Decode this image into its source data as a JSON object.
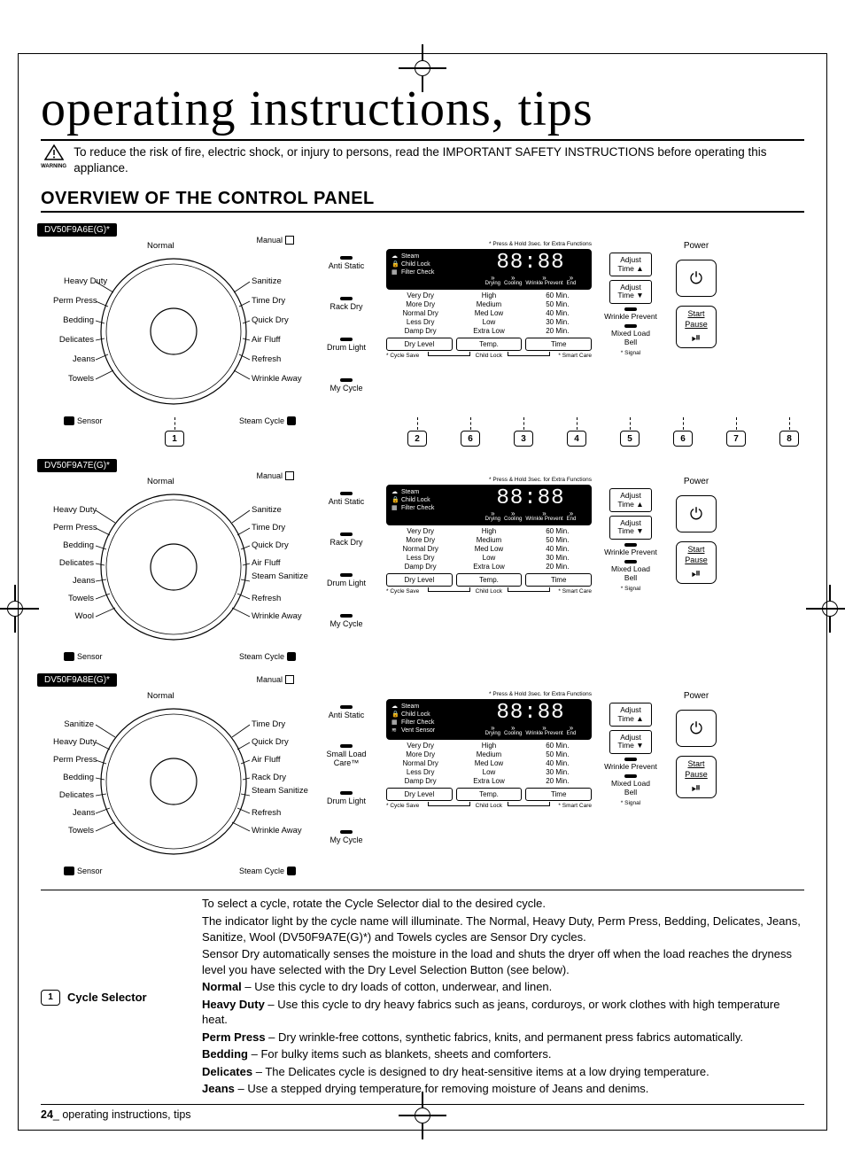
{
  "title": "operating instructions, tips",
  "warning_label": "WARNING",
  "warning_text": "To reduce the risk of fire, electric shock, or injury to persons, read the IMPORTANT SAFETY INSTRUCTIONS before operating this appliance.",
  "section_header": "OVERVIEW OF THE CONTROL PANEL",
  "press_hold_note": "* Press & Hold 3sec. for Extra Functions",
  "models": [
    {
      "id": "DV50F9A6E(G)*",
      "left_labels": [
        "Heavy Duty",
        "Perm Press",
        "Bedding",
        "Delicates",
        "Jeans",
        "Towels"
      ],
      "right_labels": [
        "Sanitize",
        "Time Dry",
        "Quick Dry",
        "Air Fluff",
        "Refresh",
        "Wrinkle Away"
      ],
      "top_label": "Normal",
      "sensor": "Sensor",
      "manual": "Manual",
      "steam": "Steam Cycle"
    },
    {
      "id": "DV50F9A7E(G)*",
      "left_labels": [
        "Heavy Duty",
        "Perm Press",
        "Bedding",
        "Delicates",
        "Jeans",
        "Towels",
        "Wool"
      ],
      "right_labels": [
        "Sanitize",
        "Time Dry",
        "Quick Dry",
        "Air Fluff",
        "Steam Sanitize",
        "Refresh",
        "Wrinkle Away"
      ],
      "top_label": "Normal",
      "sensor": "Sensor",
      "manual": "Manual",
      "steam": "Steam Cycle"
    },
    {
      "id": "DV50F9A8E(G)*",
      "left_labels": [
        "Sanitize",
        "Heavy Duty",
        "Perm Press",
        "Bedding",
        "Delicates",
        "Jeans",
        "Towels"
      ],
      "right_labels": [
        "Time Dry",
        "Quick Dry",
        "Air Fluff",
        "Rack Dry",
        "Steam Sanitize",
        "Refresh",
        "Wrinkle Away"
      ],
      "top_label": "Normal",
      "sensor": "Sensor",
      "manual": "Manual",
      "steam": "Steam Cycle"
    }
  ],
  "option_col": [
    "Anti Static",
    "Rack Dry",
    "Drum Light",
    "My Cycle"
  ],
  "option_col_8e": [
    "Anti Static",
    "Small Load Care™",
    "Drum Light",
    "My Cycle"
  ],
  "lcd": {
    "steam": "Steam",
    "child_lock": "Child Lock",
    "filter_check": "Filter Check",
    "vent_sensor": "Vent Sensor",
    "digits": "88:88",
    "progress": [
      "Drying",
      "Cooling",
      "Wrinkle Prevent",
      "End"
    ]
  },
  "grid": {
    "rows": [
      [
        "Very Dry",
        "High",
        "60 Min."
      ],
      [
        "More Dry",
        "Medium",
        "50 Min."
      ],
      [
        "Normal Dry",
        "Med Low",
        "40 Min."
      ],
      [
        "Less Dry",
        "Low",
        "30 Min."
      ],
      [
        "Damp Dry",
        "Extra Low",
        "20 Min."
      ]
    ]
  },
  "buttons": [
    "Dry Level",
    "Temp.",
    "Time"
  ],
  "foot": {
    "cycle_save": "* Cycle Save",
    "child_lock": "Child Lock",
    "smart_care": "* Smart Care",
    "signal": "* Signal"
  },
  "adjust": {
    "up": "Adjust Time ▲",
    "down": "Adjust Time ▼",
    "wrinkle": "Wrinkle Prevent",
    "mixed": "Mixed Load Bell"
  },
  "power": {
    "power": "Power",
    "start": "Start",
    "pause": "Pause"
  },
  "callouts": [
    "1",
    "2",
    "6",
    "3",
    "4",
    "5",
    "6",
    "7",
    "8"
  ],
  "table": {
    "num": "1",
    "label": "Cycle Selector",
    "paras": [
      "To select a cycle, rotate the Cycle Selector dial to the desired cycle.",
      "The indicator light by the cycle name will illuminate. The Normal, Heavy Duty, Perm Press, Bedding, Delicates, Jeans, Sanitize, Wool (DV50F9A7E(G)*) and Towels cycles are Sensor Dry cycles.",
      "Sensor Dry automatically senses the moisture in the load and shuts the dryer off when the load reaches the dryness level you have selected with the Dry Level Selection Button (see below)."
    ],
    "items": [
      {
        "b": "Normal",
        "t": " – Use this cycle to dry loads of cotton, underwear, and linen."
      },
      {
        "b": "Heavy Duty",
        "t": " – Use this cycle to dry heavy fabrics such as jeans, corduroys, or work clothes with high temperature heat."
      },
      {
        "b": "Perm Press",
        "t": " – Dry wrinkle-free cottons, synthetic fabrics, knits, and permanent press fabrics automatically."
      },
      {
        "b": "Bedding",
        "t": " – For bulky items such as blankets, sheets and comforters."
      },
      {
        "b": "Delicates",
        "t": " – The Delicates cycle is designed to dry heat-sensitive items at a low drying temperature."
      },
      {
        "b": "Jeans",
        "t": " – Use a stepped drying temperature for removing moisture of Jeans and denims."
      }
    ]
  },
  "page_num": "24",
  "footer_text": "operating instructions, tips"
}
